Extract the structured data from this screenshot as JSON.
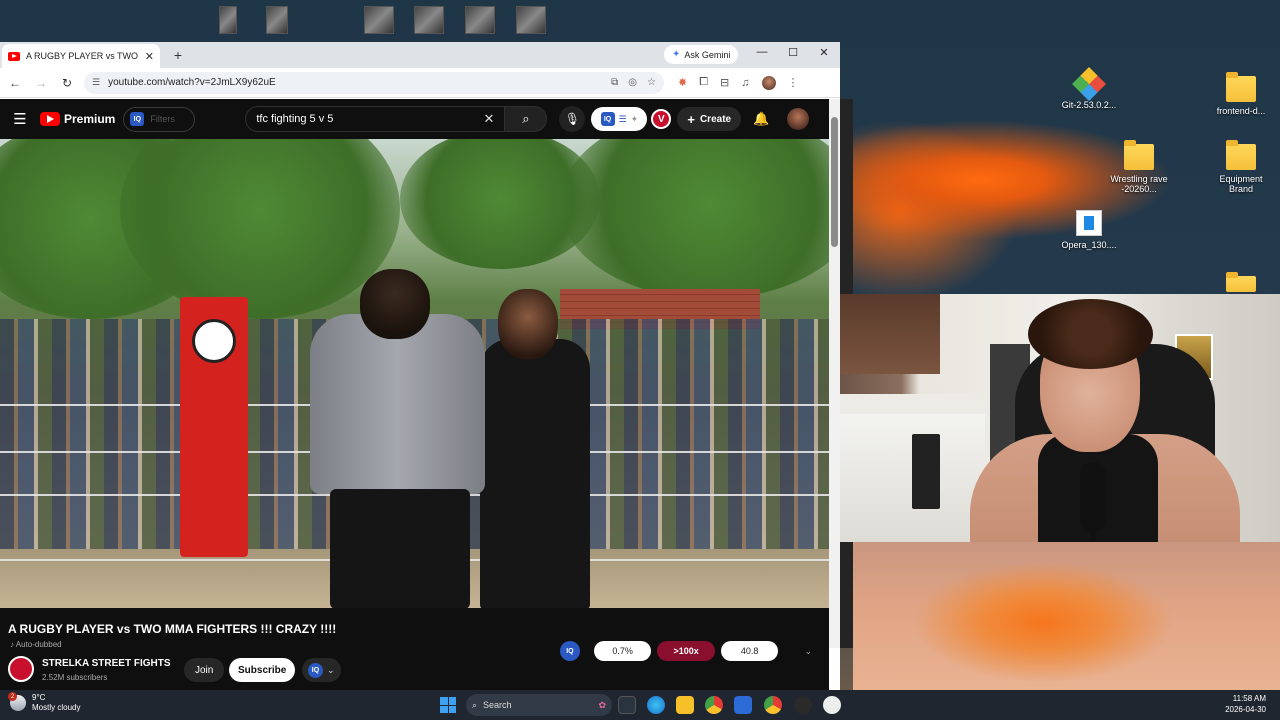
{
  "desktop": {
    "icons": [
      {
        "label": "Git-2.53.0.2..."
      },
      {
        "label": "frontend-d..."
      },
      {
        "label": "Wrestling rave -20260..."
      },
      {
        "label": "Equipment Brand"
      },
      {
        "label": "Opera_130...."
      }
    ]
  },
  "browser": {
    "tab_title": "A RUGBY PLAYER vs TWO MMA FIGHTERS !!! CRAZY !!!!",
    "ask_gemini": "Ask Gemini",
    "url": "youtube.com/watch?v=2JmLX9y62uE"
  },
  "youtube": {
    "brand": "Premium",
    "filters_placeholder": "Filters",
    "search_query": "tfc fighting 5 v 5",
    "create_label": "Create",
    "video_title": "A RUGBY PLAYER vs TWO MMA FIGHTERS !!! CRAZY !!!!",
    "auto_dubbed": "Auto-dubbed",
    "channel_name": "STRELKA STREET FIGHTS",
    "subscribers": "2.52M subscribers",
    "join_label": "Join",
    "subscribe_label": "Subscribe",
    "stats": {
      "left": "0.7%",
      "middle": ">100x",
      "right": "40.8"
    }
  },
  "taskbar": {
    "weather_badge": "2",
    "temperature": "9°C",
    "conditions": "Mostly cloudy",
    "search_placeholder": "Search",
    "time": "11:58 AM",
    "date": "2026-04-30"
  }
}
